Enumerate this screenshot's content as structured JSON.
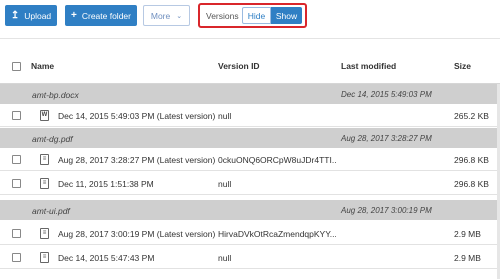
{
  "toolbar": {
    "upload_label": "Upload",
    "create_folder_label": "Create folder",
    "more_label": "More",
    "versions_label": "Versions",
    "hide_label": "Hide",
    "show_label": "Show",
    "accent_color": "#2f7fc4",
    "highlight_color": "#d9262b"
  },
  "table": {
    "columns": [
      "Name",
      "Version ID",
      "Last modified",
      "Size"
    ],
    "groups": [
      {
        "name": "amt-bp.docx",
        "last_modified": "Dec 14, 2015 5:49:03 PM",
        "versions": [
          {
            "icon": "word-doc-icon",
            "name": "Dec 14, 2015 5:49:03 PM (Latest version)",
            "version_id": "null",
            "size": "265.2 KB"
          }
        ]
      },
      {
        "name": "amt-dg.pdf",
        "last_modified": "Aug 28, 2017 3:28:27 PM",
        "versions": [
          {
            "icon": "pdf-doc-icon",
            "name": "Aug 28, 2017 3:28:27 PM (Latest version)",
            "version_id": "0ckuONQ6ORCpW8uJDr4TTI...",
            "size": "296.8 KB"
          },
          {
            "icon": "pdf-doc-icon",
            "name": "Dec 11, 2015 1:51:38 PM",
            "version_id": "null",
            "size": "296.8 KB"
          }
        ]
      },
      {
        "name": "amt-ui.pdf",
        "last_modified": "Aug 28, 2017 3:00:19 PM",
        "versions": [
          {
            "icon": "pdf-doc-icon",
            "name": "Aug 28, 2017 3:00:19 PM (Latest version)",
            "version_id": "HirvaDVkOtRcaZmendqpKYY...",
            "size": "2.9 MB"
          },
          {
            "icon": "pdf-doc-icon",
            "name": "Dec 14, 2015 5:47:43 PM",
            "version_id": "null",
            "size": "2.9 MB"
          }
        ]
      }
    ]
  }
}
